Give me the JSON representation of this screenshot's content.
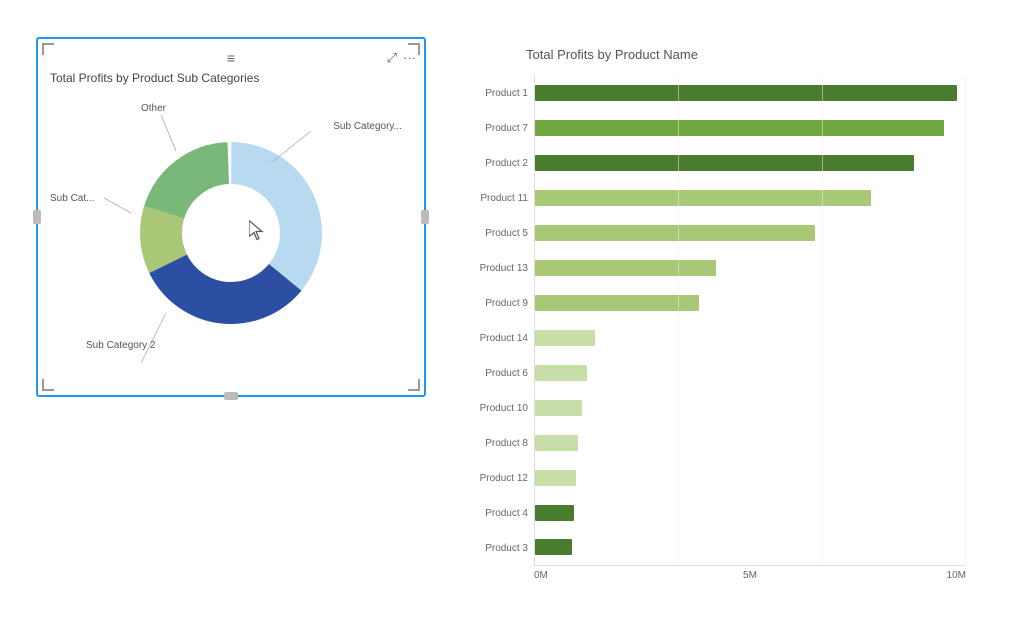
{
  "donut": {
    "title": "Total Profits by Product Sub Categories",
    "segments": [
      {
        "label": "Sub Category...",
        "color": "#2c4fa3",
        "percent": 32,
        "position": "top-right"
      },
      {
        "label": "Other",
        "color": "#a8c8a0",
        "percent": 12,
        "position": "top-center"
      },
      {
        "label": "Sub Cat...",
        "color": "#7ab87a",
        "percent": 20,
        "position": "left"
      },
      {
        "label": "Sub Category 2",
        "color": "#b8daf0",
        "percent": 36,
        "position": "bottom"
      }
    ],
    "icons": {
      "hamburger": "≡",
      "expand": "⤢",
      "more": "···"
    }
  },
  "bar_chart": {
    "title": "Total Profits by Product Name",
    "x_axis": [
      "0M",
      "5M",
      "10M"
    ],
    "products": [
      {
        "name": "Product 1",
        "value": 9.8,
        "color_class": "bar-green-dark"
      },
      {
        "name": "Product 7",
        "value": 9.5,
        "color_class": "bar-green-mid"
      },
      {
        "name": "Product 2",
        "value": 8.8,
        "color_class": "bar-green-dark"
      },
      {
        "name": "Product 11",
        "value": 7.8,
        "color_class": "bar-green-light"
      },
      {
        "name": "Product 5",
        "value": 6.5,
        "color_class": "bar-green-light"
      },
      {
        "name": "Product 13",
        "value": 4.2,
        "color_class": "bar-green-light"
      },
      {
        "name": "Product 9",
        "value": 3.8,
        "color_class": "bar-green-light"
      },
      {
        "name": "Product 14",
        "value": 1.4,
        "color_class": "bar-green-pale"
      },
      {
        "name": "Product 6",
        "value": 1.2,
        "color_class": "bar-green-pale"
      },
      {
        "name": "Product 10",
        "value": 1.1,
        "color_class": "bar-green-pale"
      },
      {
        "name": "Product 8",
        "value": 1.0,
        "color_class": "bar-green-pale"
      },
      {
        "name": "Product 12",
        "value": 0.95,
        "color_class": "bar-green-pale"
      },
      {
        "name": "Product 4",
        "value": 0.9,
        "color_class": "bar-green-dark"
      },
      {
        "name": "Product 3",
        "value": 0.85,
        "color_class": "bar-green-dark"
      }
    ],
    "max_value": 10
  }
}
